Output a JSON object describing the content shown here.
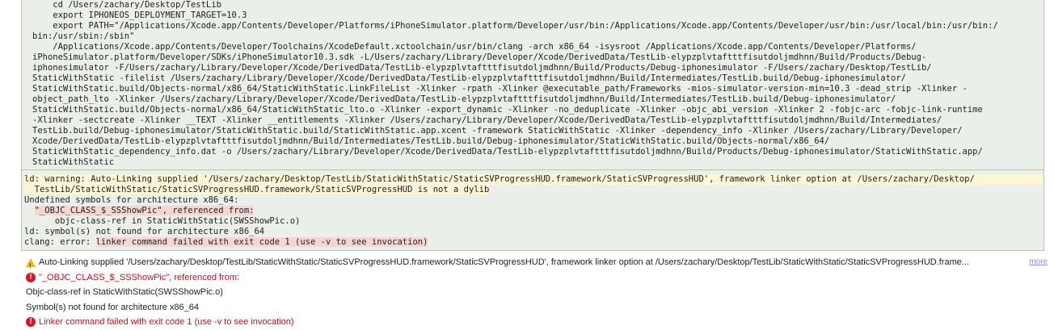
{
  "build_log": {
    "command_lines": [
      "    cd /Users/zachary/Desktop/TestLib",
      "    export IPHONEOS_DEPLOYMENT_TARGET=10.3",
      "    export PATH=\"/Applications/Xcode.app/Contents/Developer/Platforms/iPhoneSimulator.platform/Developer/usr/bin:/Applications/Xcode.app/Contents/Developer/usr/bin:/usr/local/bin:/usr/bin:/",
      "bin:/usr/sbin:/sbin\"",
      "    /Applications/Xcode.app/Contents/Developer/Toolchains/XcodeDefault.xctoolchain/usr/bin/clang -arch x86_64 -isysroot /Applications/Xcode.app/Contents/Developer/Platforms/",
      "iPhoneSimulator.platform/Developer/SDKs/iPhoneSimulator10.3.sdk -L/Users/zachary/Library/Developer/Xcode/DerivedData/TestLib-elypzplvtaftttfisutdoljmdhnn/Build/Products/Debug-",
      "iphonesimulator -F/Users/zachary/Library/Developer/Xcode/DerivedData/TestLib-elypzplvtaftttfisutdoljmdhnn/Build/Products/Debug-iphonesimulator -F/Users/zachary/Desktop/TestLib/",
      "StaticWithStatic -filelist /Users/zachary/Library/Developer/Xcode/DerivedData/TestLib-elypzplvtaftttfisutdoljmdhnn/Build/Intermediates/TestLib.build/Debug-iphonesimulator/",
      "StaticWithStatic.build/Objects-normal/x86_64/StaticWithStatic.LinkFileList -Xlinker -rpath -Xlinker @executable_path/Frameworks -mios-simulator-version-min=10.3 -dead_strip -Xlinker -",
      "object_path_lto -Xlinker /Users/zachary/Library/Developer/Xcode/DerivedData/TestLib-elypzplvtaftttfisutdoljmdhnn/Build/Intermediates/TestLib.build/Debug-iphonesimulator/",
      "StaticWithStatic.build/Objects-normal/x86_64/StaticWithStatic_lto.o -Xlinker -export_dynamic -Xlinker -no_deduplicate -Xlinker -objc_abi_version -Xlinker 2 -fobjc-arc -fobjc-link-runtime",
      "-Xlinker -sectcreate -Xlinker __TEXT -Xlinker __entitlements -Xlinker /Users/zachary/Library/Developer/Xcode/DerivedData/TestLib-elypzplvtaftttfisutdoljmdhnn/Build/Intermediates/",
      "TestLib.build/Debug-iphonesimulator/StaticWithStatic.build/StaticWithStatic.app.xcent -framework StaticWithStatic -Xlinker -dependency_info -Xlinker /Users/zachary/Library/Developer/",
      "Xcode/DerivedData/TestLib-elypzplvtaftttfisutdoljmdhnn/Build/Intermediates/TestLib.build/Debug-iphonesimulator/StaticWithStatic.build/Objects-normal/x86_64/",
      "StaticWithStatic_dependency_info.dat -o /Users/zachary/Library/Developer/Xcode/DerivedData/TestLib-elypzplvtaftttfisutdoljmdhnn/Build/Products/Debug-iphonesimulator/StaticWithStatic.app/",
      "StaticWithStatic"
    ],
    "output": {
      "warning_prefix": "ld: warning: ",
      "warning_text": "Auto-Linking supplied '/Users/zachary/Desktop/TestLib/StaticWithStatic/StaticSVProgressHUD.framework/StaticSVProgressHUD', framework linker option at /Users/zachary/Desktop/",
      "warning_cont": "  TestLib/StaticWithStatic/StaticSVProgressHUD.framework/StaticSVProgressHUD is not a dylib",
      "undefined": "Undefined symbols for architecture x86_64:",
      "symbol_indent": "  ",
      "symbol_text": "\"_OBJC_CLASS_$_SSShowPic\", referenced from:",
      "ref": "      objc-class-ref in StaticWithStatic(SWSShowPic.o)",
      "notfound": "ld: symbol(s) not found for architecture x86_64",
      "clang_prefix": "clang: error: ",
      "clang_text": "linker command failed with exit code 1 (use -v to see invocation)"
    }
  },
  "issues": [
    {
      "type": "warning",
      "icon": "warning-triangle-icon",
      "text": "Auto-Linking supplied '/Users/zachary/Desktop/TestLib/StaticWithStatic/StaticSVProgressHUD.framework/StaticSVProgressHUD', framework linker option at /Users/zachary/Desktop/TestLib/StaticWithStatic/StaticSVProgressHUD.frame...",
      "more": "more"
    },
    {
      "type": "error",
      "icon": "error-icon",
      "text": "\"_OBJC_CLASS_$_SSShowPic\", referenced from:"
    },
    {
      "type": "note",
      "text": "Objc-class-ref in StaticWithStatic(SWSShowPic.o)"
    },
    {
      "type": "note",
      "text": "Symbol(s) not found for architecture x86_64"
    },
    {
      "type": "error",
      "icon": "error-icon",
      "text": "Linker command failed with exit code 1 (use -v to see invocation)"
    }
  ],
  "colors": {
    "error": "#c0141c",
    "warning_icon": "#f3b81d",
    "warning_highlight": "#fcf5d6",
    "error_highlight": "#f8d5d5",
    "log_background": "#ebefe9"
  }
}
